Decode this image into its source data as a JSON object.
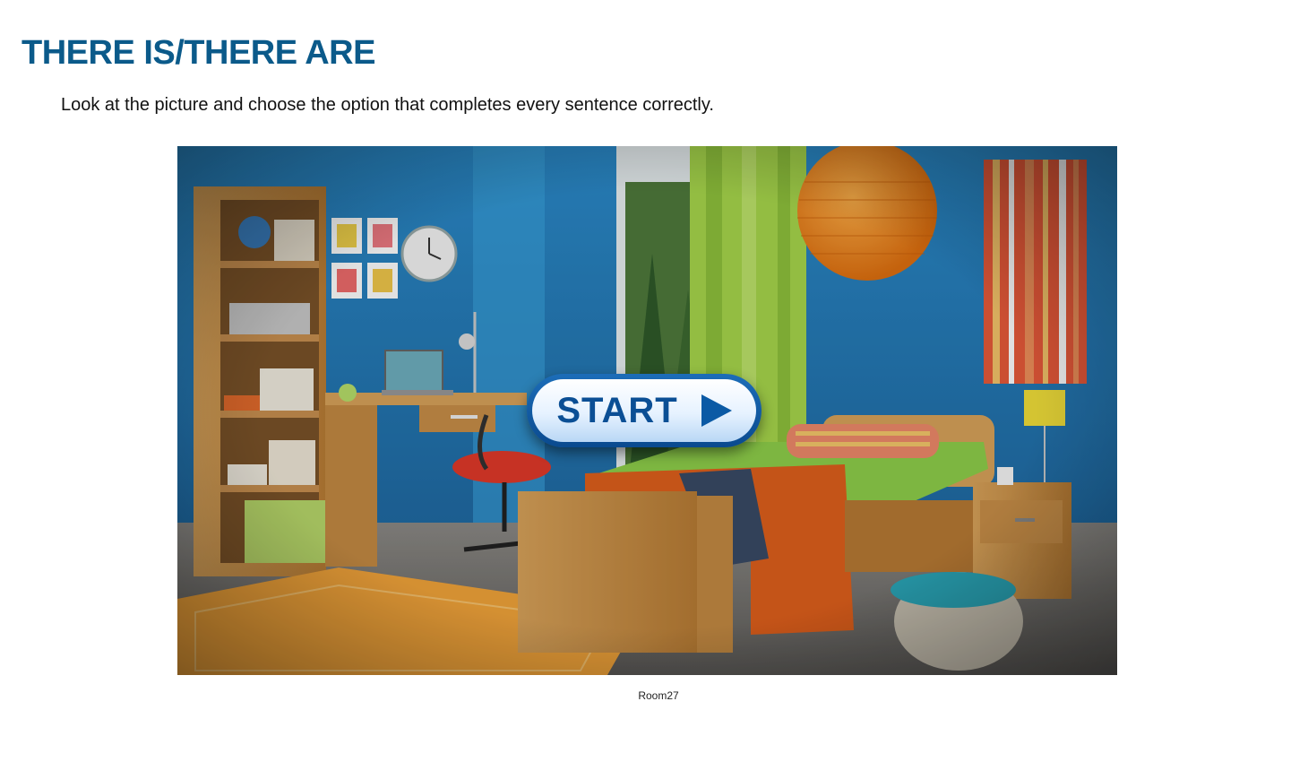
{
  "page": {
    "title": "THERE IS/THERE ARE",
    "instructions": "Look at the picture and choose the option that completes every sentence correctly.",
    "caption": "Room27"
  },
  "start_button": {
    "label": "START",
    "icon": "play-icon"
  },
  "colors": {
    "title": "#0b5a8a",
    "button_blue": "#0b4f95",
    "wall_blue": "#2f8fc9",
    "curtain_green": "#9fd04a",
    "lamp_orange": "#f08a1c"
  }
}
